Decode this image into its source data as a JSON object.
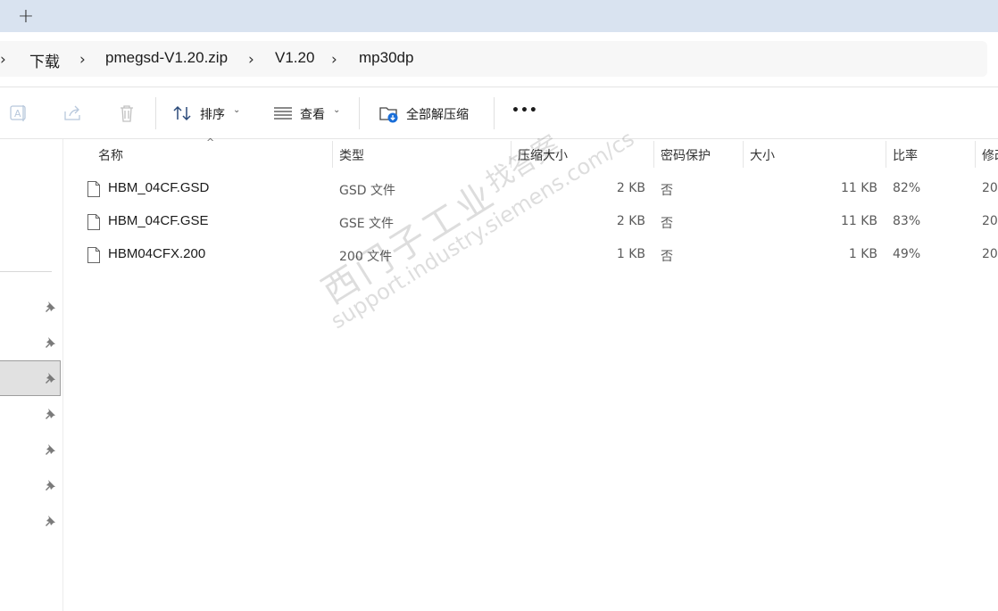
{
  "tabbar": {
    "new_tab_label": "+"
  },
  "breadcrumb": {
    "items": [
      "下载",
      "pmegsd-V1.20.zip",
      "V1.20",
      "mp30dp"
    ]
  },
  "toolbar": {
    "sort_label": "排序",
    "view_label": "查看",
    "extract_all_label": "全部解压缩",
    "more_label": "•••"
  },
  "columns": {
    "name": "名称",
    "type": "类型",
    "compressed_size": "压缩大小",
    "password": "密码保护",
    "size": "大小",
    "ratio": "比率",
    "modified": "修改"
  },
  "files": [
    {
      "name": "HBM_04CF.GSD",
      "type": "GSD 文件",
      "compressed": "2 KB",
      "password": "否",
      "size": "11 KB",
      "ratio": "82%",
      "modified": "20"
    },
    {
      "name": "HBM_04CF.GSE",
      "type": "GSE 文件",
      "compressed": "2 KB",
      "password": "否",
      "size": "11 KB",
      "ratio": "83%",
      "modified": "20"
    },
    {
      "name": "HBM04CFX.200",
      "type": "200 文件",
      "compressed": "1 KB",
      "password": "否",
      "size": "1 KB",
      "ratio": "49%",
      "modified": "20"
    }
  ],
  "watermark": {
    "line1": "西门子工业",
    "line2": "找答案",
    "line3": "support.industry.siemens.com/cs"
  },
  "colors": {
    "tabbar": "#d9e3f0",
    "selected_nav": "#e1e1e1",
    "extract_icon_accent": "#1a6ed8"
  }
}
